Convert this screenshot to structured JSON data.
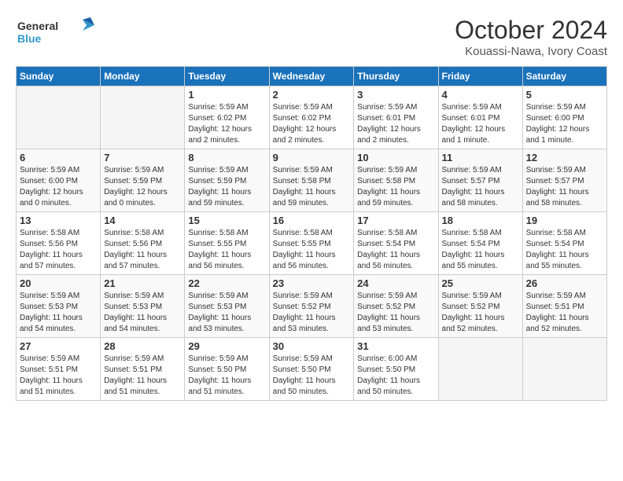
{
  "header": {
    "logo_line1": "General",
    "logo_line2": "Blue",
    "month_title": "October 2024",
    "location": "Kouassi-Nawa, Ivory Coast"
  },
  "weekdays": [
    "Sunday",
    "Monday",
    "Tuesday",
    "Wednesday",
    "Thursday",
    "Friday",
    "Saturday"
  ],
  "weeks": [
    [
      {
        "day": "",
        "empty": true
      },
      {
        "day": "",
        "empty": true
      },
      {
        "day": "1",
        "info": "Sunrise: 5:59 AM\nSunset: 6:02 PM\nDaylight: 12 hours\nand 2 minutes."
      },
      {
        "day": "2",
        "info": "Sunrise: 5:59 AM\nSunset: 6:02 PM\nDaylight: 12 hours\nand 2 minutes."
      },
      {
        "day": "3",
        "info": "Sunrise: 5:59 AM\nSunset: 6:01 PM\nDaylight: 12 hours\nand 2 minutes."
      },
      {
        "day": "4",
        "info": "Sunrise: 5:59 AM\nSunset: 6:01 PM\nDaylight: 12 hours\nand 1 minute."
      },
      {
        "day": "5",
        "info": "Sunrise: 5:59 AM\nSunset: 6:00 PM\nDaylight: 12 hours\nand 1 minute."
      }
    ],
    [
      {
        "day": "6",
        "info": "Sunrise: 5:59 AM\nSunset: 6:00 PM\nDaylight: 12 hours\nand 0 minutes."
      },
      {
        "day": "7",
        "info": "Sunrise: 5:59 AM\nSunset: 5:59 PM\nDaylight: 12 hours\nand 0 minutes."
      },
      {
        "day": "8",
        "info": "Sunrise: 5:59 AM\nSunset: 5:59 PM\nDaylight: 11 hours\nand 59 minutes."
      },
      {
        "day": "9",
        "info": "Sunrise: 5:59 AM\nSunset: 5:58 PM\nDaylight: 11 hours\nand 59 minutes."
      },
      {
        "day": "10",
        "info": "Sunrise: 5:59 AM\nSunset: 5:58 PM\nDaylight: 11 hours\nand 59 minutes."
      },
      {
        "day": "11",
        "info": "Sunrise: 5:59 AM\nSunset: 5:57 PM\nDaylight: 11 hours\nand 58 minutes."
      },
      {
        "day": "12",
        "info": "Sunrise: 5:59 AM\nSunset: 5:57 PM\nDaylight: 11 hours\nand 58 minutes."
      }
    ],
    [
      {
        "day": "13",
        "info": "Sunrise: 5:58 AM\nSunset: 5:56 PM\nDaylight: 11 hours\nand 57 minutes."
      },
      {
        "day": "14",
        "info": "Sunrise: 5:58 AM\nSunset: 5:56 PM\nDaylight: 11 hours\nand 57 minutes."
      },
      {
        "day": "15",
        "info": "Sunrise: 5:58 AM\nSunset: 5:55 PM\nDaylight: 11 hours\nand 56 minutes."
      },
      {
        "day": "16",
        "info": "Sunrise: 5:58 AM\nSunset: 5:55 PM\nDaylight: 11 hours\nand 56 minutes."
      },
      {
        "day": "17",
        "info": "Sunrise: 5:58 AM\nSunset: 5:54 PM\nDaylight: 11 hours\nand 56 minutes."
      },
      {
        "day": "18",
        "info": "Sunrise: 5:58 AM\nSunset: 5:54 PM\nDaylight: 11 hours\nand 55 minutes."
      },
      {
        "day": "19",
        "info": "Sunrise: 5:58 AM\nSunset: 5:54 PM\nDaylight: 11 hours\nand 55 minutes."
      }
    ],
    [
      {
        "day": "20",
        "info": "Sunrise: 5:59 AM\nSunset: 5:53 PM\nDaylight: 11 hours\nand 54 minutes."
      },
      {
        "day": "21",
        "info": "Sunrise: 5:59 AM\nSunset: 5:53 PM\nDaylight: 11 hours\nand 54 minutes."
      },
      {
        "day": "22",
        "info": "Sunrise: 5:59 AM\nSunset: 5:53 PM\nDaylight: 11 hours\nand 53 minutes."
      },
      {
        "day": "23",
        "info": "Sunrise: 5:59 AM\nSunset: 5:52 PM\nDaylight: 11 hours\nand 53 minutes."
      },
      {
        "day": "24",
        "info": "Sunrise: 5:59 AM\nSunset: 5:52 PM\nDaylight: 11 hours\nand 53 minutes."
      },
      {
        "day": "25",
        "info": "Sunrise: 5:59 AM\nSunset: 5:52 PM\nDaylight: 11 hours\nand 52 minutes."
      },
      {
        "day": "26",
        "info": "Sunrise: 5:59 AM\nSunset: 5:51 PM\nDaylight: 11 hours\nand 52 minutes."
      }
    ],
    [
      {
        "day": "27",
        "info": "Sunrise: 5:59 AM\nSunset: 5:51 PM\nDaylight: 11 hours\nand 51 minutes."
      },
      {
        "day": "28",
        "info": "Sunrise: 5:59 AM\nSunset: 5:51 PM\nDaylight: 11 hours\nand 51 minutes."
      },
      {
        "day": "29",
        "info": "Sunrise: 5:59 AM\nSunset: 5:50 PM\nDaylight: 11 hours\nand 51 minutes."
      },
      {
        "day": "30",
        "info": "Sunrise: 5:59 AM\nSunset: 5:50 PM\nDaylight: 11 hours\nand 50 minutes."
      },
      {
        "day": "31",
        "info": "Sunrise: 6:00 AM\nSunset: 5:50 PM\nDaylight: 11 hours\nand 50 minutes."
      },
      {
        "day": "",
        "empty": true
      },
      {
        "day": "",
        "empty": true
      }
    ]
  ]
}
